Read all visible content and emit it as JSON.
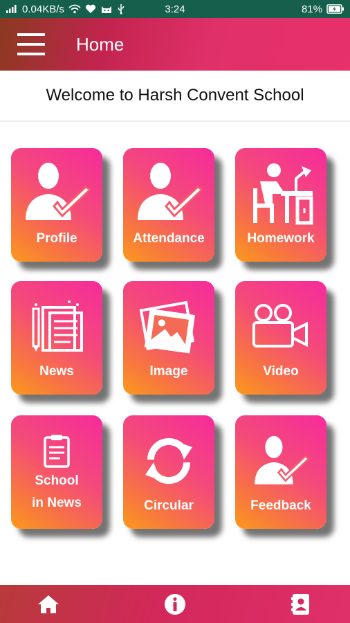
{
  "status_bar": {
    "network_speed": "0.04KB/s",
    "time": "3:24",
    "battery": "81%",
    "icons": [
      "signal-icon",
      "wifi-icon",
      "heart-icon",
      "cat-icon",
      "usb-icon",
      "battery-charging-icon"
    ]
  },
  "app_bar": {
    "title": "Home",
    "menu_icon": "hamburger-menu-icon"
  },
  "welcome_text": "Welcome to Harsh Convent School",
  "tiles": [
    {
      "label": "Profile",
      "icon": "person-check-icon"
    },
    {
      "label": "Attendance",
      "icon": "person-check-icon"
    },
    {
      "label": "Homework",
      "icon": "student-desk-icon"
    },
    {
      "label": "News",
      "icon": "document-pencil-icon"
    },
    {
      "label": "Image",
      "icon": "photos-icon"
    },
    {
      "label": "Video",
      "icon": "video-camera-icon"
    },
    {
      "label_line1": "School",
      "label_line2": "in News",
      "icon": "clipboard-icon"
    },
    {
      "label": "Circular",
      "icon": "refresh-arrows-icon"
    },
    {
      "label": "Feedback",
      "icon": "person-check-icon"
    }
  ],
  "bottom_nav": {
    "items": [
      "home-icon",
      "info-icon",
      "contacts-icon"
    ]
  },
  "colors": {
    "status_bar": "#155f4c",
    "app_bar_accent": "#e0306a",
    "tile_top": "#f62b9c",
    "tile_bottom": "#fb9a1d"
  }
}
